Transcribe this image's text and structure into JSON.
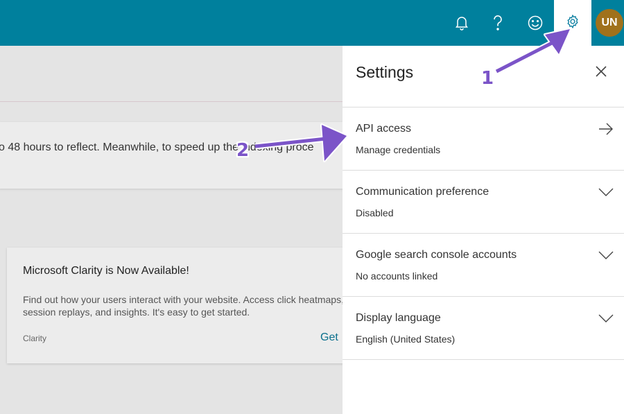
{
  "topbar": {
    "icons": [
      "bell-icon",
      "help-icon",
      "smiley-icon",
      "gear-icon"
    ],
    "avatar_initials": "UN",
    "colors": {
      "bar": "#00809d",
      "avatar": "#a0711c"
    }
  },
  "background": {
    "banner_text": "o 48 hours to reflect. Meanwhile, to speed up the indexing proce",
    "card": {
      "title": "Microsoft Clarity is Now Available!",
      "description": "Find out how your users interact with your website. Access click heatmaps, session replays, and insights. It's easy to get started.",
      "source": "Clarity",
      "cta": "Get"
    }
  },
  "settings": {
    "title": "Settings",
    "items": [
      {
        "label": "API access",
        "value": "Manage credentials",
        "icon": "arrow-right-icon"
      },
      {
        "label": "Communication preference",
        "value": "Disabled",
        "icon": "chevron-down-icon"
      },
      {
        "label": "Google search console accounts",
        "value": "No accounts linked",
        "icon": "chevron-down-icon"
      },
      {
        "label": "Display language",
        "value": "English (United States)",
        "icon": "chevron-down-icon"
      }
    ]
  },
  "annotations": {
    "step1": "1",
    "step2": "2",
    "color": "#7b54c8"
  }
}
